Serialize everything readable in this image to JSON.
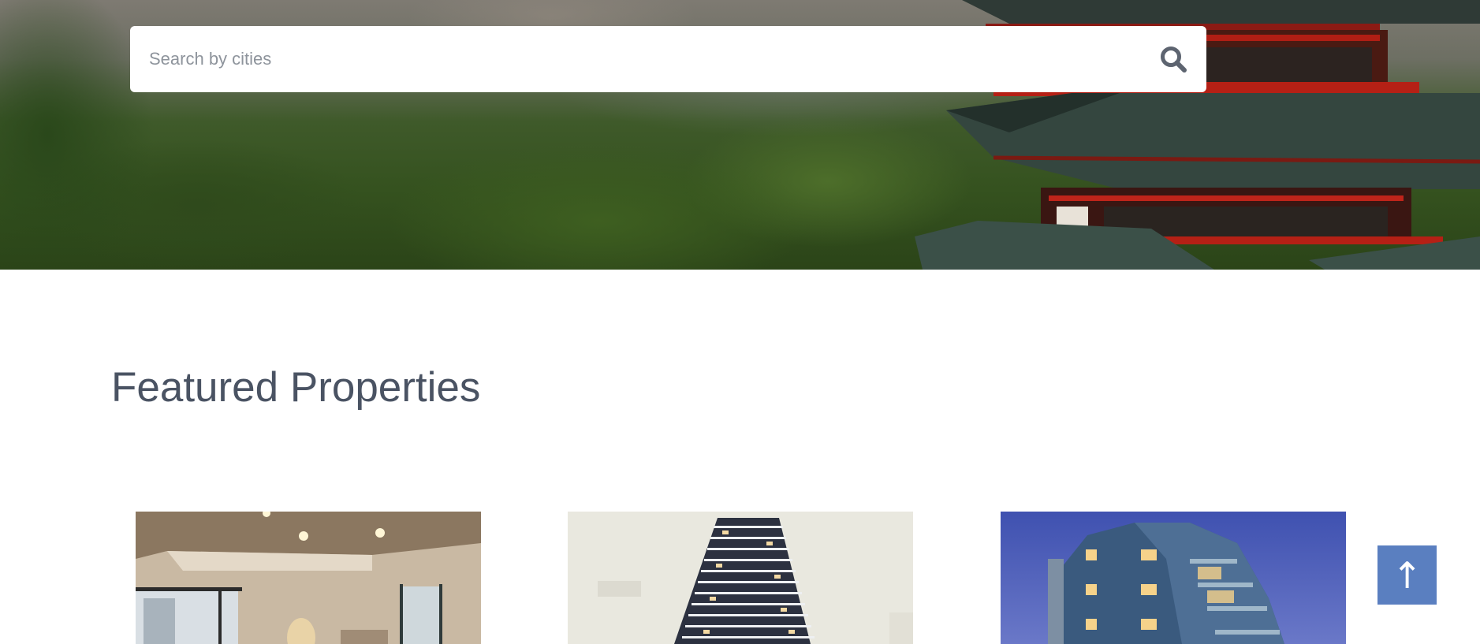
{
  "search": {
    "placeholder": "Search by cities",
    "icon": "search-icon"
  },
  "featured": {
    "title": "Featured Properties"
  },
  "scroll_top": {
    "glyph": "↑",
    "icon": "arrow-up-icon",
    "color": "#5a7fc0"
  },
  "colors": {
    "title_text": "#4a5363",
    "search_icon": "#5d6470"
  }
}
